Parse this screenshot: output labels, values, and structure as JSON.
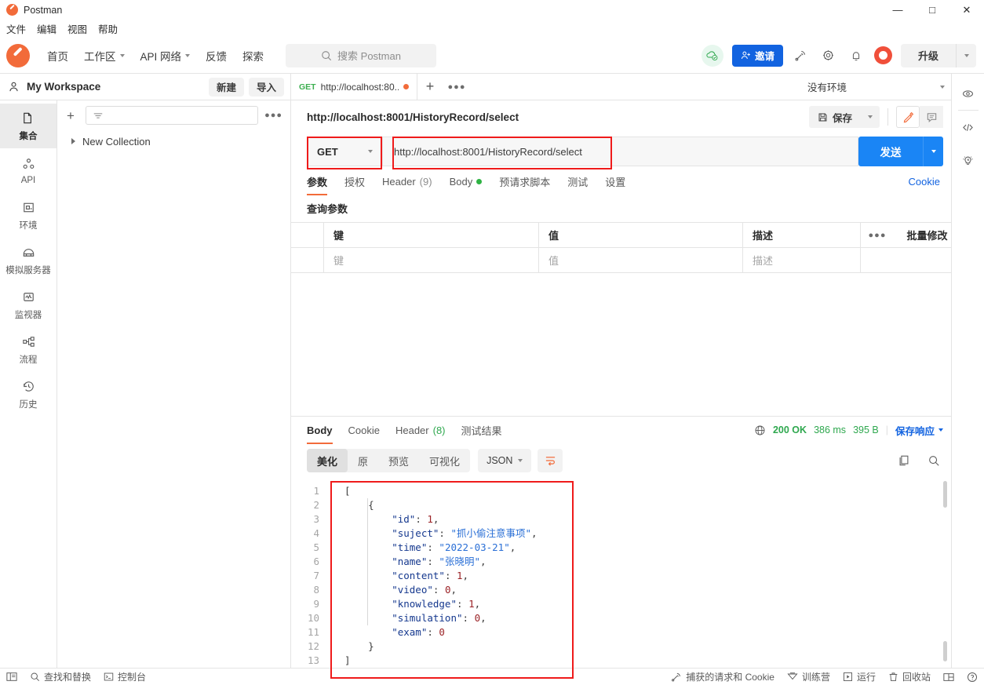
{
  "window": {
    "title": "Postman",
    "controls": [
      "minimize",
      "maximize",
      "close"
    ]
  },
  "menubar": [
    "文件",
    "编辑",
    "视图",
    "帮助"
  ],
  "toolbar": {
    "nav": [
      {
        "label": "首页",
        "caret": false
      },
      {
        "label": "工作区",
        "caret": true
      },
      {
        "label": "API 网络",
        "caret": true
      },
      {
        "label": "反馈",
        "caret": false
      },
      {
        "label": "探索",
        "caret": false
      }
    ],
    "search_placeholder": "搜索 Postman",
    "invite_label": "邀请",
    "upgrade_label": "升级",
    "icons": [
      "cloud-sync-icon",
      "satellite-icon",
      "gear-icon",
      "bell-icon",
      "avatar"
    ]
  },
  "workspace": {
    "name": "My Workspace",
    "new_label": "新建",
    "import_label": "导入"
  },
  "sidebar": {
    "items": [
      {
        "label": "集合",
        "icon": "collection-icon",
        "active": true
      },
      {
        "label": "API",
        "icon": "api-icon",
        "active": false
      },
      {
        "label": "环境",
        "icon": "environment-icon",
        "active": false
      },
      {
        "label": "模拟服务器",
        "icon": "mock-server-icon",
        "active": false
      },
      {
        "label": "监视器",
        "icon": "monitor-icon",
        "active": false
      },
      {
        "label": "流程",
        "icon": "flow-icon",
        "active": false
      },
      {
        "label": "历史",
        "icon": "history-icon",
        "active": false
      }
    ]
  },
  "collections": {
    "filter_placeholder": "",
    "tree": [
      {
        "label": "New Collection"
      }
    ]
  },
  "tabs": {
    "open": [
      {
        "method": "GET",
        "title": "http://localhost:80...",
        "unsaved": true
      }
    ],
    "environment": "没有环境"
  },
  "request": {
    "title": "http://localhost:8001/HistoryRecord/select",
    "save_label": "保存",
    "method": "GET",
    "url": "http://localhost:8001/HistoryRecord/select",
    "send_label": "发送",
    "tabs": [
      {
        "label": "参数",
        "active": true
      },
      {
        "label": "授权",
        "active": false
      },
      {
        "label": "Header",
        "count": "(9)",
        "active": false
      },
      {
        "label": "Body",
        "dot": true,
        "active": false
      },
      {
        "label": "预请求脚本",
        "active": false
      },
      {
        "label": "测试",
        "active": false
      },
      {
        "label": "设置",
        "active": false
      }
    ],
    "cookie_link": "Cookie",
    "query_params_title": "查询参数",
    "table": {
      "headers": [
        "键",
        "值",
        "描述"
      ],
      "bulk_edit_label": "批量修改",
      "placeholder_row": [
        "键",
        "值",
        "描述"
      ]
    }
  },
  "response": {
    "tabs": [
      {
        "label": "Body",
        "active": true
      },
      {
        "label": "Cookie",
        "active": false
      },
      {
        "label": "Header",
        "count": "(8)",
        "active": false
      },
      {
        "label": "测试结果",
        "active": false
      }
    ],
    "status": "200 OK",
    "time": "386 ms",
    "size": "395 B",
    "save_response_label": "保存响应",
    "view_modes": [
      {
        "label": "美化",
        "active": true
      },
      {
        "label": "原",
        "active": false
      },
      {
        "label": "预览",
        "active": false
      },
      {
        "label": "可视化",
        "active": false
      }
    ],
    "format": "JSON",
    "body_lines": [
      {
        "n": 1,
        "tokens": [
          {
            "t": "p",
            "v": "["
          }
        ]
      },
      {
        "n": 2,
        "tokens": [
          {
            "t": "p",
            "v": "    {"
          }
        ]
      },
      {
        "n": 3,
        "tokens": [
          {
            "t": "k",
            "v": "        \"id\""
          },
          {
            "t": "p",
            "v": ": "
          },
          {
            "t": "n",
            "v": "1"
          },
          {
            "t": "p",
            "v": ","
          }
        ]
      },
      {
        "n": 4,
        "tokens": [
          {
            "t": "k",
            "v": "        \"suject\""
          },
          {
            "t": "p",
            "v": ": "
          },
          {
            "t": "s",
            "v": "\"抓小偷注意事项\""
          },
          {
            "t": "p",
            "v": ","
          }
        ]
      },
      {
        "n": 5,
        "tokens": [
          {
            "t": "k",
            "v": "        \"time\""
          },
          {
            "t": "p",
            "v": ": "
          },
          {
            "t": "s",
            "v": "\"2022-03-21\""
          },
          {
            "t": "p",
            "v": ","
          }
        ]
      },
      {
        "n": 6,
        "tokens": [
          {
            "t": "k",
            "v": "        \"name\""
          },
          {
            "t": "p",
            "v": ": "
          },
          {
            "t": "s",
            "v": "\"张晓明\""
          },
          {
            "t": "p",
            "v": ","
          }
        ]
      },
      {
        "n": 7,
        "tokens": [
          {
            "t": "k",
            "v": "        \"content\""
          },
          {
            "t": "p",
            "v": ": "
          },
          {
            "t": "n",
            "v": "1"
          },
          {
            "t": "p",
            "v": ","
          }
        ]
      },
      {
        "n": 8,
        "tokens": [
          {
            "t": "k",
            "v": "        \"video\""
          },
          {
            "t": "p",
            "v": ": "
          },
          {
            "t": "n",
            "v": "0"
          },
          {
            "t": "p",
            "v": ","
          }
        ]
      },
      {
        "n": 9,
        "tokens": [
          {
            "t": "k",
            "v": "        \"knowledge\""
          },
          {
            "t": "p",
            "v": ": "
          },
          {
            "t": "n",
            "v": "1"
          },
          {
            "t": "p",
            "v": ","
          }
        ]
      },
      {
        "n": 10,
        "tokens": [
          {
            "t": "k",
            "v": "        \"simulation\""
          },
          {
            "t": "p",
            "v": ": "
          },
          {
            "t": "n",
            "v": "0"
          },
          {
            "t": "p",
            "v": ","
          }
        ]
      },
      {
        "n": 11,
        "tokens": [
          {
            "t": "k",
            "v": "        \"exam\""
          },
          {
            "t": "p",
            "v": ": "
          },
          {
            "t": "n",
            "v": "0"
          }
        ]
      },
      {
        "n": 12,
        "tokens": [
          {
            "t": "p",
            "v": "    }"
          }
        ]
      },
      {
        "n": 13,
        "tokens": [
          {
            "t": "p",
            "v": "]"
          }
        ]
      }
    ]
  },
  "right_rail": [
    "eye-icon",
    "code-icon",
    "lightbulb-icon"
  ],
  "statusbar": {
    "left": [
      {
        "label": "",
        "icon": "sidebar-toggle-icon"
      },
      {
        "label": "查找和替换",
        "icon": "search-icon"
      },
      {
        "label": "控制台",
        "icon": "console-icon"
      }
    ],
    "right": [
      {
        "label": "捕获的请求和 Cookie",
        "icon": "capture-icon"
      },
      {
        "label": "训练营",
        "icon": "bootcamp-icon"
      },
      {
        "label": "运行",
        "icon": "runner-icon"
      },
      {
        "label": "回收站",
        "icon": "trash-icon"
      },
      {
        "label": "",
        "icon": "layout-icon"
      },
      {
        "label": "",
        "icon": "help-icon"
      }
    ]
  },
  "colors": {
    "accent": "#f26b3a",
    "primary": "#1a85f5",
    "link": "#1263e0",
    "success": "#2fa84f",
    "annotation": "#ef1b1b"
  }
}
